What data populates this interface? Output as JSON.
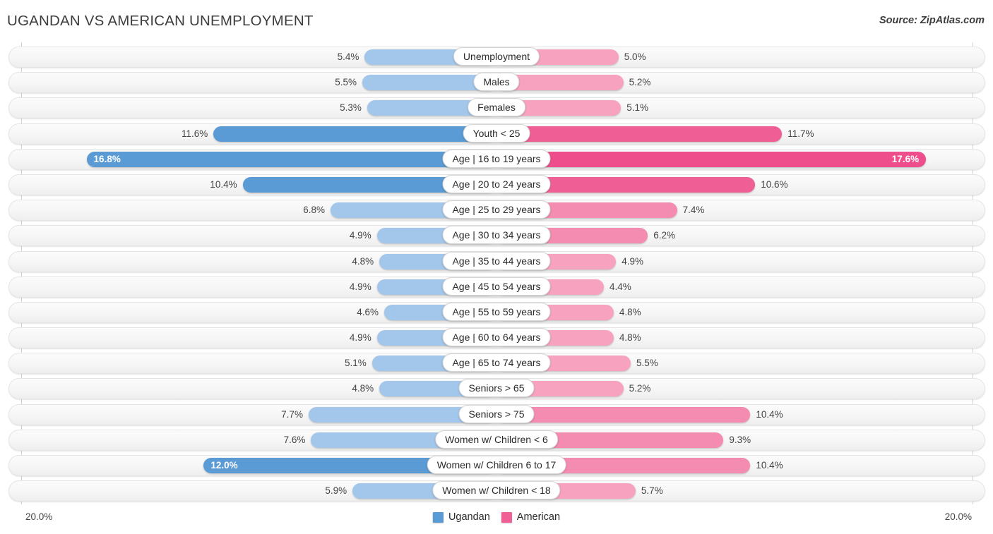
{
  "header": {
    "title": "UGANDAN VS AMERICAN UNEMPLOYMENT",
    "source": "Source: ZipAtlas.com"
  },
  "axis": {
    "left_label": "20.0%",
    "right_label": "20.0%",
    "max": 20.0
  },
  "legend": {
    "items": [
      {
        "label": "Ugandan",
        "color": "#5b9bd5"
      },
      {
        "label": "American",
        "color": "#ef5f96"
      }
    ]
  },
  "colors": {
    "left_light": "#a3c6eb",
    "left_dark": "#5b9bd5",
    "right_light": "#f7a3c0",
    "right_dark": "#ef5f96",
    "track": "#f5f5f5",
    "axis": "#d2d2d2"
  },
  "chart_data": {
    "type": "bar",
    "title": "UGANDAN VS AMERICAN UNEMPLOYMENT",
    "subtitle": "Source: ZipAtlas.com",
    "orientation": "horizontal-diverging",
    "xlabel": "",
    "ylabel": "",
    "xlim": [
      0,
      20.0
    ],
    "axis_tick_labels": [
      "20.0%",
      "20.0%"
    ],
    "grid": false,
    "legend_position": "bottom-center",
    "categories": [
      "Unemployment",
      "Males",
      "Females",
      "Youth < 25",
      "Age | 16 to 19 years",
      "Age | 20 to 24 years",
      "Age | 25 to 29 years",
      "Age | 30 to 34 years",
      "Age | 35 to 44 years",
      "Age | 45 to 54 years",
      "Age | 55 to 59 years",
      "Age | 60 to 64 years",
      "Age | 65 to 74 years",
      "Seniors > 65",
      "Seniors > 75",
      "Women w/ Children < 6",
      "Women w/ Children 6 to 17",
      "Women w/ Children < 18"
    ],
    "series": [
      {
        "name": "Ugandan",
        "color": "#5b9bd5",
        "values": [
          5.4,
          5.5,
          5.3,
          11.6,
          16.8,
          10.4,
          6.8,
          4.9,
          4.8,
          4.9,
          4.6,
          4.9,
          5.1,
          4.8,
          7.7,
          7.6,
          12.0,
          5.9
        ],
        "labels": [
          "5.4%",
          "5.5%",
          "5.3%",
          "11.6%",
          "16.8%",
          "10.4%",
          "6.8%",
          "4.9%",
          "4.8%",
          "4.9%",
          "4.6%",
          "4.9%",
          "5.1%",
          "4.8%",
          "7.7%",
          "7.6%",
          "12.0%",
          "5.9%"
        ]
      },
      {
        "name": "American",
        "color": "#ef5f96",
        "values": [
          5.0,
          5.2,
          5.1,
          11.7,
          17.6,
          10.6,
          7.4,
          6.2,
          4.9,
          4.4,
          4.8,
          4.8,
          5.5,
          5.2,
          10.4,
          9.3,
          10.4,
          5.7
        ],
        "labels": [
          "5.0%",
          "5.2%",
          "5.1%",
          "11.7%",
          "17.6%",
          "10.6%",
          "7.4%",
          "6.2%",
          "4.9%",
          "4.4%",
          "4.8%",
          "4.8%",
          "5.5%",
          "5.2%",
          "10.4%",
          "9.3%",
          "10.4%",
          "5.7%"
        ]
      }
    ]
  },
  "rows": [
    {
      "label": "Unemployment",
      "left": 5.4,
      "left_label": "5.4%",
      "right": 5.0,
      "right_label": "5.0%",
      "left_tone": "light",
      "right_tone": "light",
      "left_inside": false,
      "right_inside": false
    },
    {
      "label": "Males",
      "left": 5.5,
      "left_label": "5.5%",
      "right": 5.2,
      "right_label": "5.2%",
      "left_tone": "light",
      "right_tone": "light",
      "left_inside": false,
      "right_inside": false
    },
    {
      "label": "Females",
      "left": 5.3,
      "left_label": "5.3%",
      "right": 5.1,
      "right_label": "5.1%",
      "left_tone": "light",
      "right_tone": "light",
      "left_inside": false,
      "right_inside": false
    },
    {
      "label": "Youth < 25",
      "left": 11.6,
      "left_label": "11.6%",
      "right": 11.7,
      "right_label": "11.7%",
      "left_tone": "dark",
      "right_tone": "dark",
      "left_inside": false,
      "right_inside": false
    },
    {
      "label": "Age | 16 to 19 years",
      "left": 16.8,
      "left_label": "16.8%",
      "right": 17.6,
      "right_label": "17.6%",
      "left_tone": "dark",
      "right_tone": "darker",
      "left_inside": true,
      "right_inside": true
    },
    {
      "label": "Age | 20 to 24 years",
      "left": 10.4,
      "left_label": "10.4%",
      "right": 10.6,
      "right_label": "10.6%",
      "left_tone": "dark",
      "right_tone": "dark",
      "left_inside": false,
      "right_inside": false
    },
    {
      "label": "Age | 25 to 29 years",
      "left": 6.8,
      "left_label": "6.8%",
      "right": 7.4,
      "right_label": "7.4%",
      "left_tone": "light",
      "right_tone": "mid",
      "left_inside": false,
      "right_inside": false
    },
    {
      "label": "Age | 30 to 34 years",
      "left": 4.9,
      "left_label": "4.9%",
      "right": 6.2,
      "right_label": "6.2%",
      "left_tone": "light",
      "right_tone": "mid",
      "left_inside": false,
      "right_inside": false
    },
    {
      "label": "Age | 35 to 44 years",
      "left": 4.8,
      "left_label": "4.8%",
      "right": 4.9,
      "right_label": "4.9%",
      "left_tone": "light",
      "right_tone": "light",
      "left_inside": false,
      "right_inside": false
    },
    {
      "label": "Age | 45 to 54 years",
      "left": 4.9,
      "left_label": "4.9%",
      "right": 4.4,
      "right_label": "4.4%",
      "left_tone": "light",
      "right_tone": "light",
      "left_inside": false,
      "right_inside": false
    },
    {
      "label": "Age | 55 to 59 years",
      "left": 4.6,
      "left_label": "4.6%",
      "right": 4.8,
      "right_label": "4.8%",
      "left_tone": "light",
      "right_tone": "light",
      "left_inside": false,
      "right_inside": false
    },
    {
      "label": "Age | 60 to 64 years",
      "left": 4.9,
      "left_label": "4.9%",
      "right": 4.8,
      "right_label": "4.8%",
      "left_tone": "light",
      "right_tone": "light",
      "left_inside": false,
      "right_inside": false
    },
    {
      "label": "Age | 65 to 74 years",
      "left": 5.1,
      "left_label": "5.1%",
      "right": 5.5,
      "right_label": "5.5%",
      "left_tone": "light",
      "right_tone": "light",
      "left_inside": false,
      "right_inside": false
    },
    {
      "label": "Seniors > 65",
      "left": 4.8,
      "left_label": "4.8%",
      "right": 5.2,
      "right_label": "5.2%",
      "left_tone": "light",
      "right_tone": "light",
      "left_inside": false,
      "right_inside": false
    },
    {
      "label": "Seniors > 75",
      "left": 7.7,
      "left_label": "7.7%",
      "right": 10.4,
      "right_label": "10.4%",
      "left_tone": "light",
      "right_tone": "mid",
      "left_inside": false,
      "right_inside": false
    },
    {
      "label": "Women w/ Children < 6",
      "left": 7.6,
      "left_label": "7.6%",
      "right": 9.3,
      "right_label": "9.3%",
      "left_tone": "light",
      "right_tone": "mid",
      "left_inside": false,
      "right_inside": false
    },
    {
      "label": "Women w/ Children 6 to 17",
      "left": 12.0,
      "left_label": "12.0%",
      "right": 10.4,
      "right_label": "10.4%",
      "left_tone": "dark",
      "right_tone": "mid",
      "left_inside": true,
      "right_inside": false
    },
    {
      "label": "Women w/ Children < 18",
      "left": 5.9,
      "left_label": "5.9%",
      "right": 5.7,
      "right_label": "5.7%",
      "left_tone": "light",
      "right_tone": "light",
      "left_inside": false,
      "right_inside": false
    }
  ]
}
